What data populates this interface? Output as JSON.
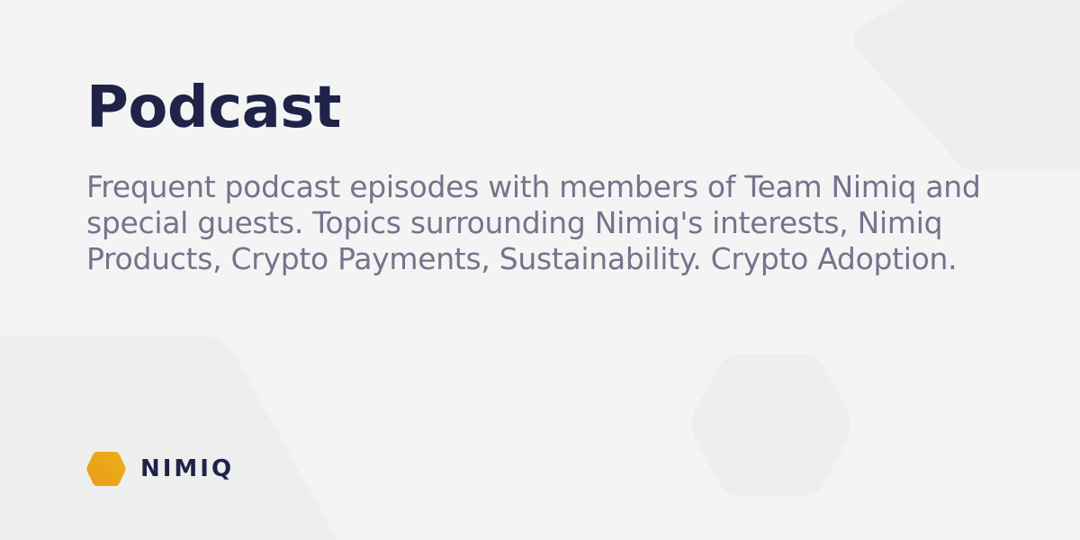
{
  "header": {
    "title": "Podcast"
  },
  "description": {
    "text": "Frequent podcast episodes with members of Team Nimiq and special guests. Topics surrounding Nimiq's interests, Nimiq Products, Crypto Payments, Sustainability. Crypto Adoption."
  },
  "brand": {
    "name": "NIMIQ",
    "icon": "nimiq-hexagon-icon"
  },
  "colors": {
    "background": "#f4f4f4",
    "title": "#1f2348",
    "description": "#73748c",
    "brand_gold_start": "#ec991c",
    "brand_gold_end": "#e9b213"
  }
}
